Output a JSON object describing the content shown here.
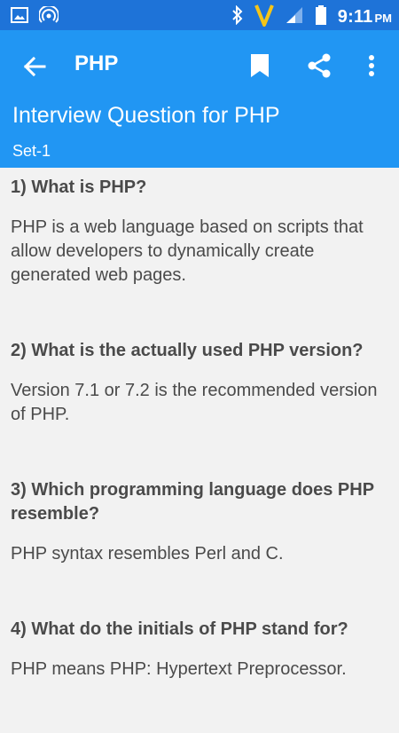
{
  "status": {
    "time": "9:11",
    "ampm": "PM",
    "carrier_mark": "V"
  },
  "toolbar": {
    "title": "PHP"
  },
  "header": {
    "title": "Interview Question for PHP",
    "subtitle": "Set-1"
  },
  "questions": [
    {
      "q": "1) What is PHP?",
      "a": "PHP is a web language based on scripts that allow developers to dynamically create generated web pages."
    },
    {
      "q": "2) What is the actually used PHP version?",
      "a": "Version 7.1 or 7.2 is the recommended version of PHP."
    },
    {
      "q": "3) Which programming language does PHP resemble?",
      "a": "PHP syntax resembles Perl and C."
    },
    {
      "q": "4) What do the initials of PHP stand for?",
      "a": "PHP means PHP: Hypertext Preprocessor."
    }
  ],
  "colors": {
    "status_bar": "#1e73d8",
    "toolbar": "#2196f3",
    "background": "#f2f2f2",
    "text": "#4a4a4a"
  },
  "icons": [
    "image-icon",
    "hotspot-icon",
    "bluetooth-icon",
    "signal-icon",
    "battery-icon",
    "back-arrow-icon",
    "bookmark-icon",
    "share-icon",
    "more-vert-icon"
  ]
}
